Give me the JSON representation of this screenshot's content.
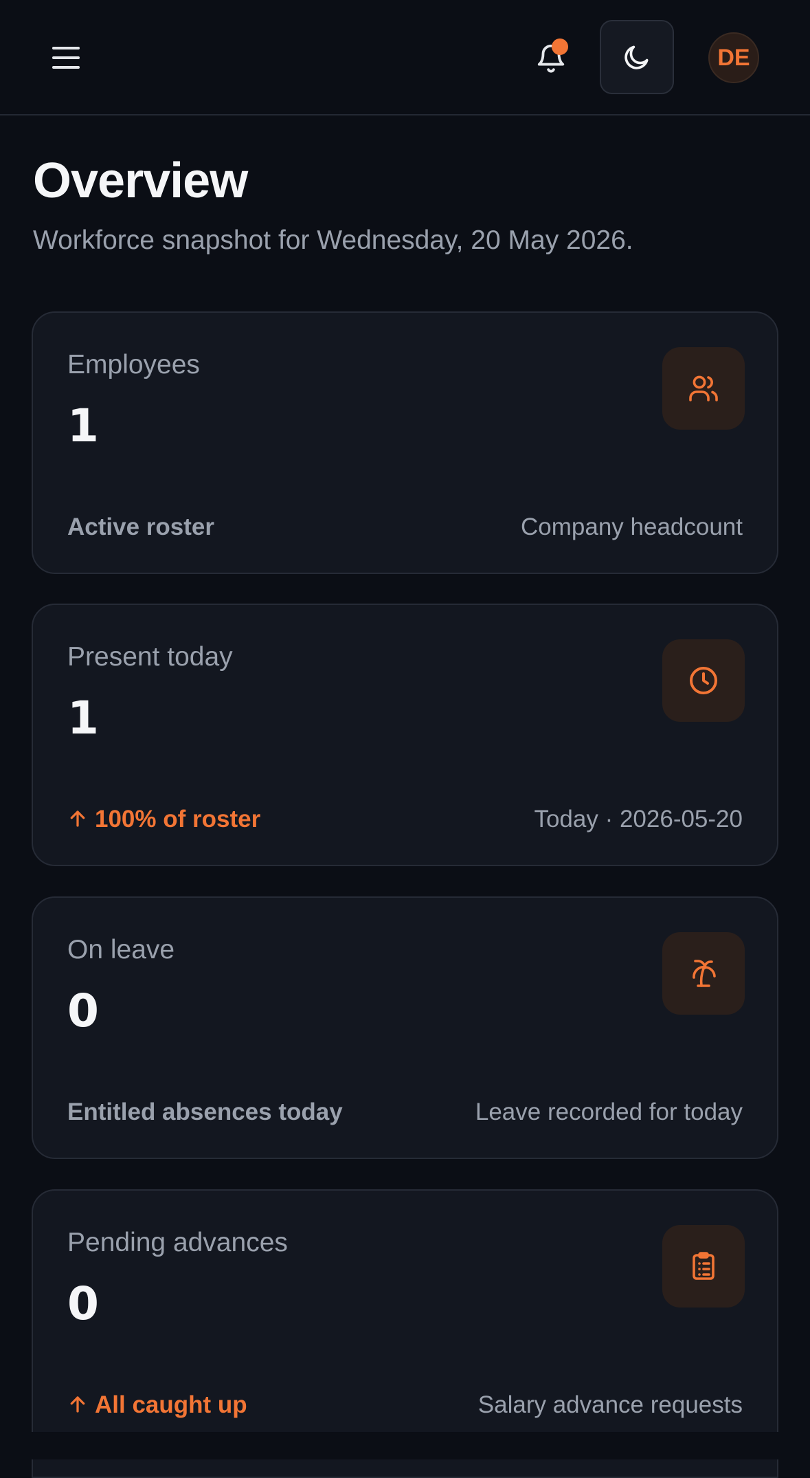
{
  "header": {
    "notification_badge": true,
    "avatar_initials": "DE"
  },
  "page": {
    "title": "Overview",
    "subtitle": "Workforce snapshot for Wednesday, 20 May 2026."
  },
  "cards": [
    {
      "label": "Employees",
      "value": "1",
      "foot_left": "Active roster",
      "foot_right": "Company headcount",
      "icon": "users-icon"
    },
    {
      "label": "Present today",
      "value": "1",
      "foot_left": "100% of roster",
      "foot_right": "Today · 2026-05-20",
      "icon": "clock-icon"
    },
    {
      "label": "On leave",
      "value": "0",
      "foot_left": "Entitled absences today",
      "foot_right": "Leave recorded for today",
      "icon": "palm-tree-icon"
    },
    {
      "label": "Pending advances",
      "value": "0",
      "foot_left": "All caught up",
      "foot_right": "Salary advance requests",
      "icon": "clipboard-list-icon"
    }
  ],
  "colors": {
    "background": "#0b0e15",
    "card": "#131720",
    "accent": "#f27535",
    "muted": "#9aa1ad"
  }
}
